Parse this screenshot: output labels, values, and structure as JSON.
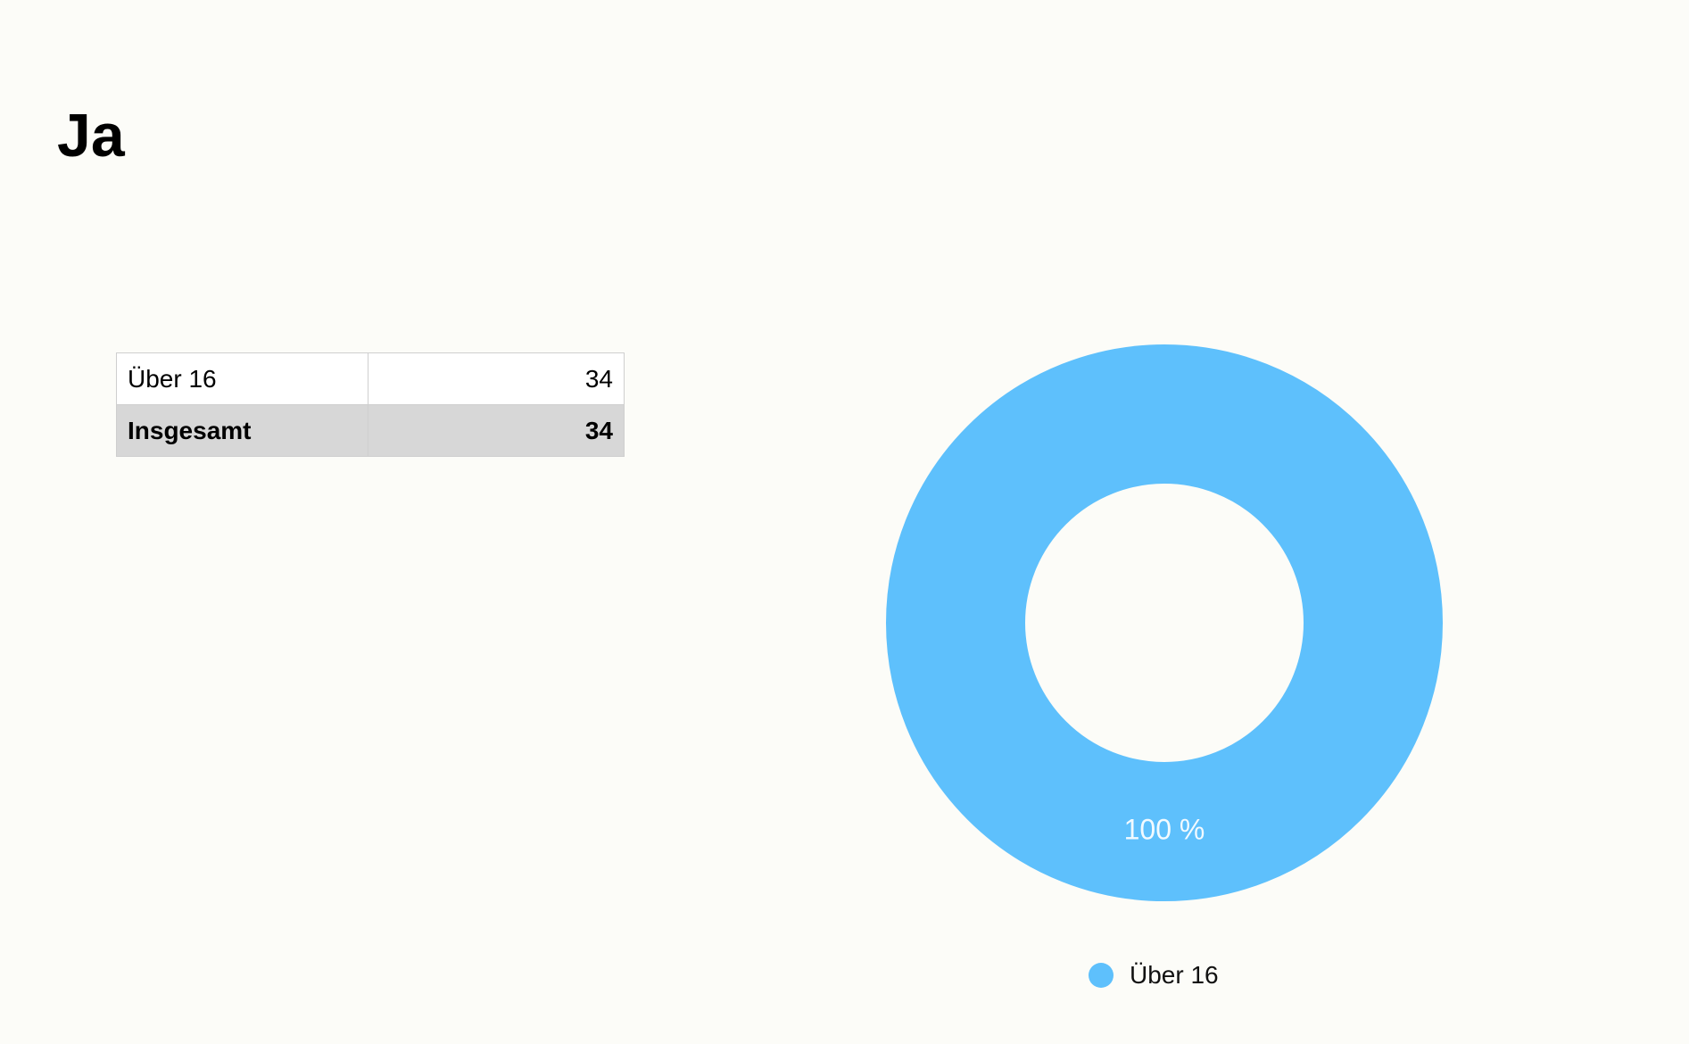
{
  "slide": {
    "title": "Ja"
  },
  "table": {
    "rows": [
      {
        "label": "Über 16",
        "value": "34"
      }
    ],
    "total": {
      "label": "Insgesamt",
      "value": "34"
    }
  },
  "chart_data": {
    "type": "pie",
    "variant": "donut",
    "title": "",
    "categories": [
      "Über 16"
    ],
    "values": [
      34
    ],
    "slice_labels": [
      "100 %"
    ],
    "colors": [
      "#5ec0fc"
    ],
    "legend": {
      "position": "bottom",
      "entries": [
        "Über 16"
      ]
    }
  }
}
